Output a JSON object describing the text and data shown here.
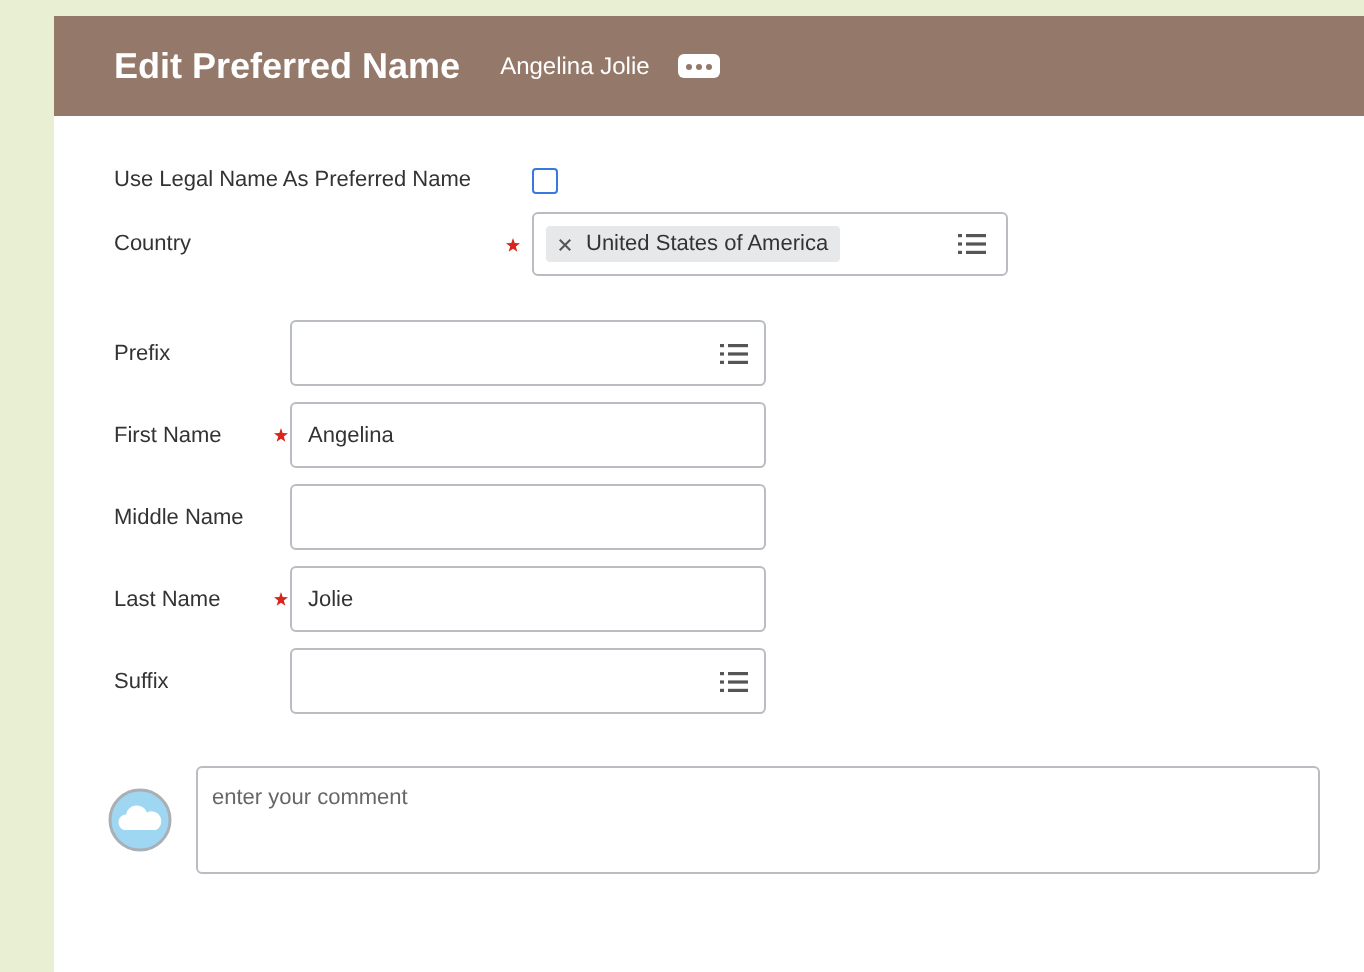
{
  "header": {
    "title": "Edit Preferred Name",
    "subtitle": "Angelina Jolie"
  },
  "use_legal_name": {
    "label": "Use Legal Name As Preferred Name",
    "checked": false
  },
  "country": {
    "label": "Country",
    "required": true,
    "value": "United States of America"
  },
  "fields": [
    {
      "label": "Prefix",
      "kind": "select",
      "required": false
    },
    {
      "label": "First Name",
      "kind": "text",
      "required": true,
      "value": "Angelina"
    },
    {
      "label": "Middle Name",
      "kind": "text",
      "required": false
    },
    {
      "label": "Last Name",
      "kind": "text",
      "required": true,
      "value": "Jolie"
    },
    {
      "label": "Suffix",
      "kind": "select",
      "required": false
    }
  ],
  "comment": {
    "placeholder": "enter your comment"
  }
}
